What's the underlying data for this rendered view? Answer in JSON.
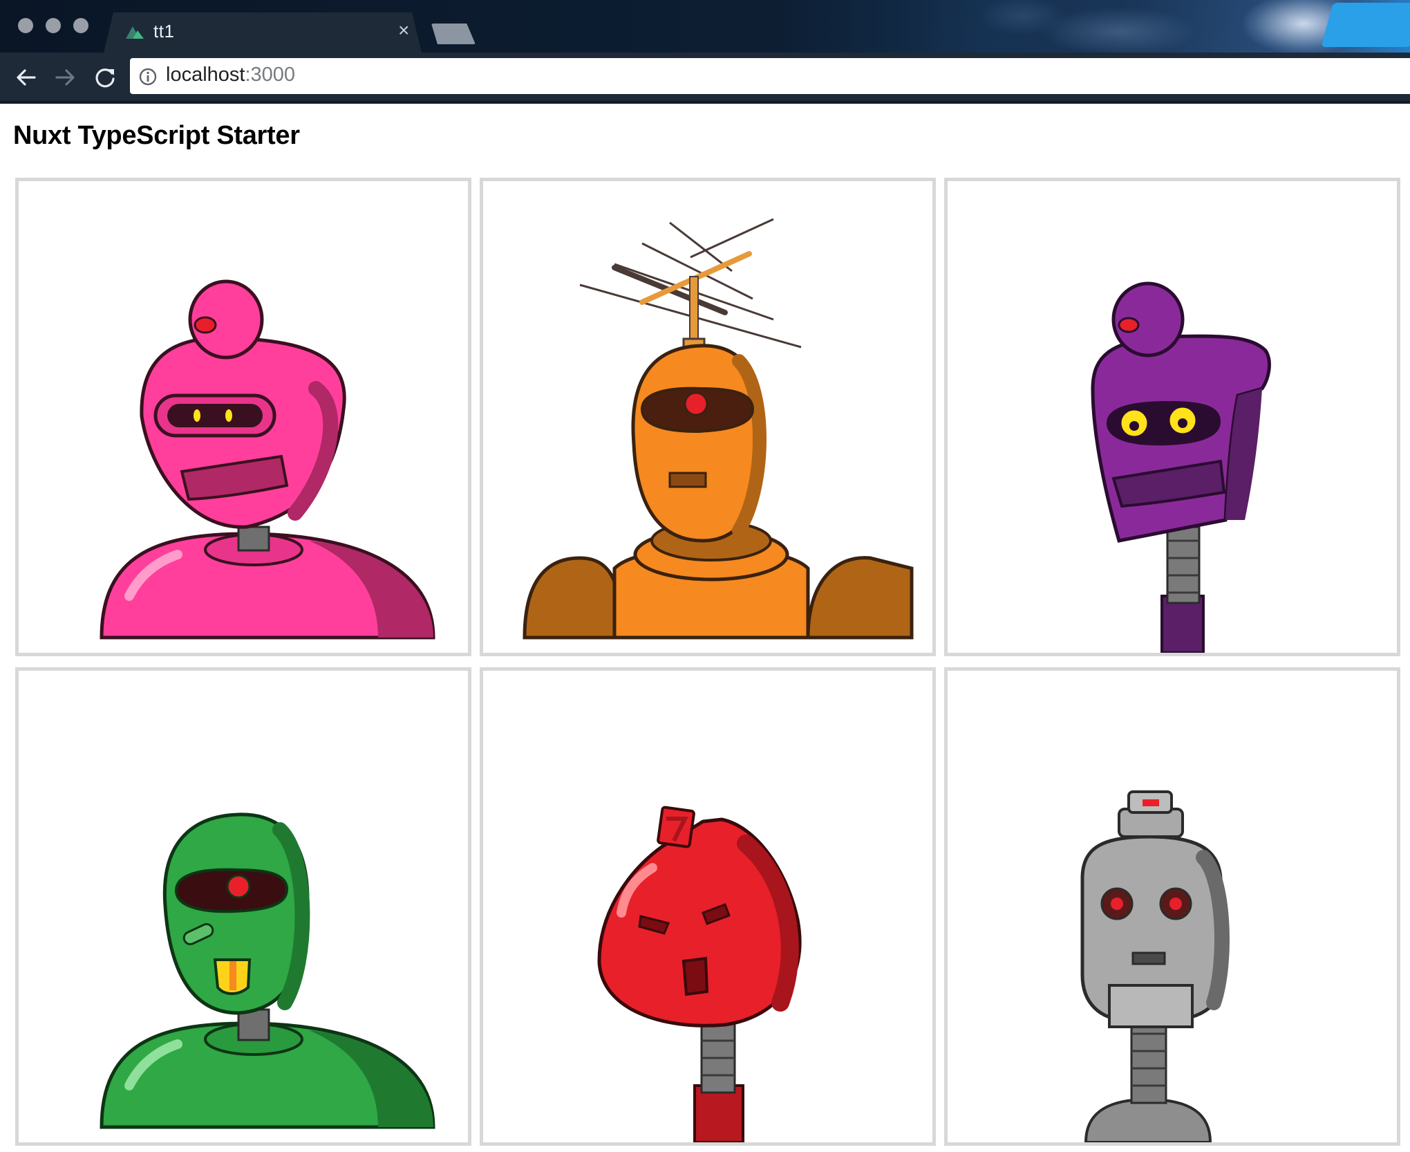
{
  "browser": {
    "tab": {
      "title": "tt1"
    },
    "address": {
      "host": "localhost",
      "port": ":3000"
    }
  },
  "page": {
    "title": "Nuxt TypeScript Starter"
  },
  "robots": [
    {
      "color": "#ff3f9b",
      "icon": "pink-robot-image"
    },
    {
      "color": "#f6891f",
      "icon": "orange-robot-image"
    },
    {
      "color": "#8a2a9a",
      "icon": "purple-robot-image"
    },
    {
      "color": "#2fa845",
      "icon": "green-robot-image"
    },
    {
      "color": "#e8202a",
      "icon": "red-robot-image"
    },
    {
      "color": "#8e8e8e",
      "icon": "gray-robot-image"
    }
  ]
}
